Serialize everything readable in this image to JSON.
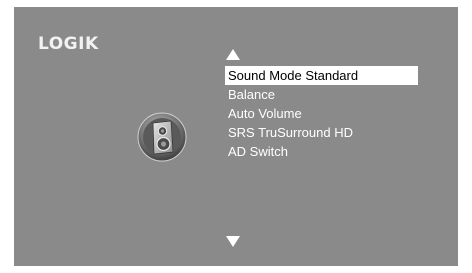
{
  "brand": {
    "logo_text": "LOGIK"
  },
  "menu": {
    "scroll_up_icon": "triangle-up-icon",
    "scroll_down_icon": "triangle-down-icon",
    "items": [
      {
        "label": "Sound Mode Standard",
        "selected": true
      },
      {
        "label": "Balance",
        "selected": false
      },
      {
        "label": "Auto Volume",
        "selected": false
      },
      {
        "label": "SRS TruSurround HD",
        "selected": false
      },
      {
        "label": "AD Switch",
        "selected": false
      }
    ]
  },
  "section_icon": "speaker-icon",
  "colors": {
    "background": "#8a8a8a",
    "text": "#ffffff",
    "highlight_bg": "#ffffff",
    "highlight_text": "#000000"
  }
}
